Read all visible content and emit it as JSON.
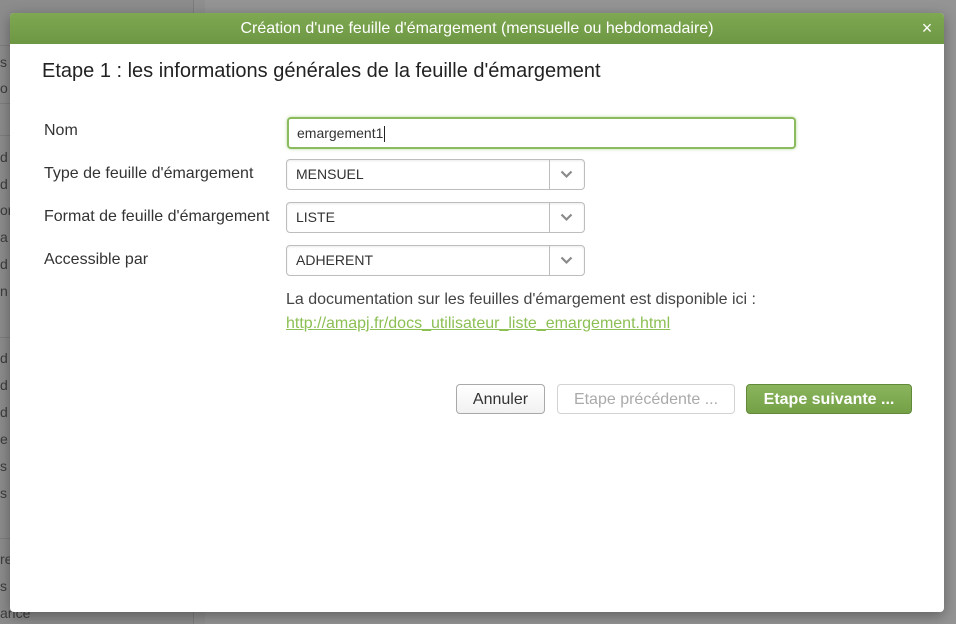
{
  "background": {
    "sidebar_fragments": [
      "s",
      "o",
      "d",
      "d",
      "or",
      "a",
      "d",
      "n",
      "d",
      "d",
      "d",
      "e",
      "s",
      "s",
      "re",
      "s",
      "ance"
    ]
  },
  "dialog": {
    "title": "Création d'une feuille d'émargement (mensuelle ou hebdomadaire)",
    "close_label": "×",
    "step_title": "Etape 1 : les informations générales de la feuille d'émargement"
  },
  "form": {
    "nom": {
      "label": "Nom",
      "value": "emargement1"
    },
    "type": {
      "label": "Type de feuille d'émargement",
      "value": "MENSUEL"
    },
    "format": {
      "label": "Format de feuille d'émargement",
      "value": "LISTE"
    },
    "accessible": {
      "label": "Accessible par",
      "value": "ADHERENT"
    }
  },
  "documentation": {
    "text": "La documentation sur les feuilles d'émargement est disponible ici :",
    "link": "http://amapj.fr/docs_utilisateur_liste_emargement.html"
  },
  "buttons": {
    "cancel": "Annuler",
    "previous": "Etape précédente ...",
    "next": "Etape suivante ..."
  },
  "colors": {
    "header_green": "#74a046",
    "link_green": "#8cbf54",
    "focus_green": "#8bbb5f"
  }
}
